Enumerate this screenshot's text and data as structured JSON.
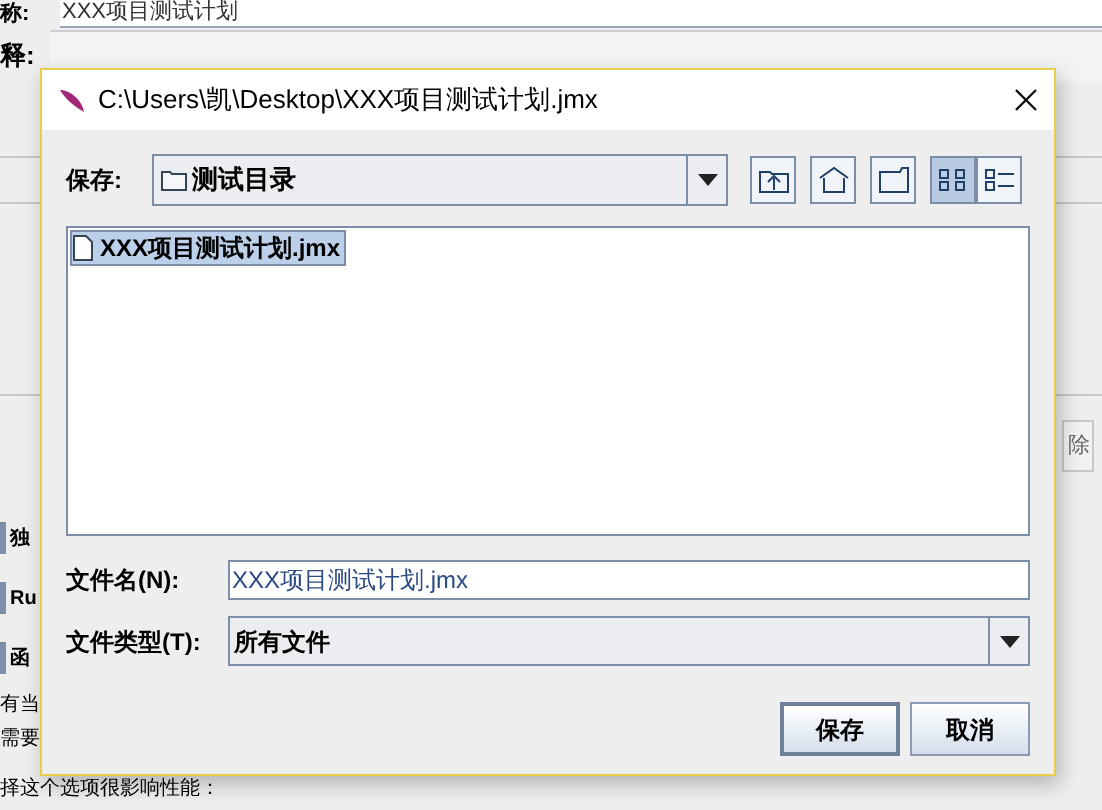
{
  "background": {
    "name_label": "称:",
    "name_value": "XXX项目测试计划",
    "comment_label": "释:",
    "side_button": "除",
    "fragments": [
      {
        "kind": "check",
        "text": "独"
      },
      {
        "kind": "check",
        "text": "Ru"
      },
      {
        "kind": "check",
        "text": "函"
      },
      {
        "kind": "plain",
        "text": "有当"
      },
      {
        "kind": "plain",
        "text": "需要"
      },
      {
        "kind": "plain",
        "text": "择这个选项很影响性能："
      }
    ]
  },
  "dialog": {
    "title": "C:\\Users\\凯\\Desktop\\XXX项目测试计划.jmx",
    "save_in": {
      "label": "保存:",
      "value": "测试目录"
    },
    "toolbar": [
      {
        "kind": "up",
        "selected": false
      },
      {
        "kind": "home",
        "selected": false
      },
      {
        "kind": "new-folder",
        "selected": false
      },
      {
        "kind": "list",
        "selected": true
      },
      {
        "kind": "details",
        "selected": false
      }
    ],
    "files": [
      {
        "name": "XXX项目测试计划.jmx",
        "selected": true
      }
    ],
    "file_name": {
      "label": "文件名(N):",
      "value": "XXX项目测试计划.jmx"
    },
    "file_type": {
      "label": "文件类型(T):",
      "value": "所有文件"
    },
    "buttons": [
      {
        "label": "保存",
        "default": true
      },
      {
        "label": "取消",
        "default": false
      }
    ]
  }
}
